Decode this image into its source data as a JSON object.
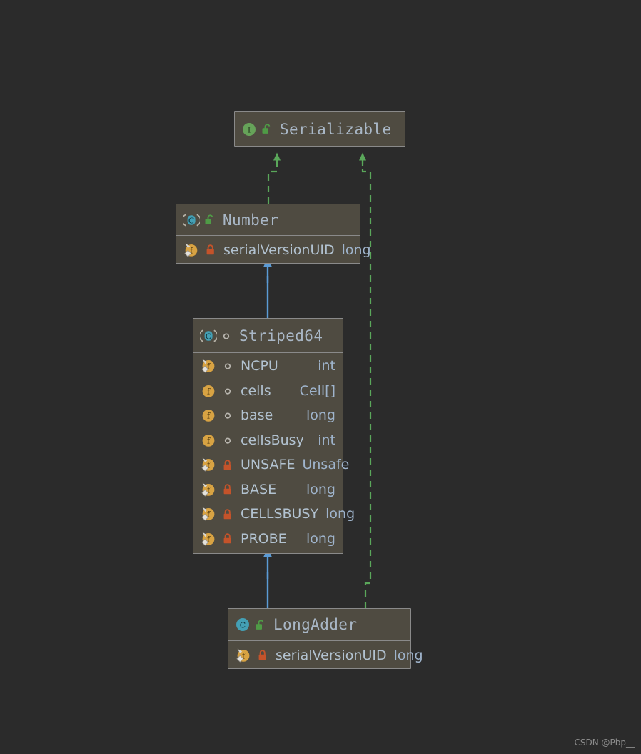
{
  "diagram": {
    "title": "UML Class Diagram",
    "background_color": "#2b2b2b",
    "node_fill_color": "#4f4b41",
    "node_border_color": "#8a8a8a",
    "inheritance_edge_color": "#5b9bd5",
    "realization_edge_color": "#5aa75a",
    "class_name_color": "#a9b7c6",
    "member_name_color": "#b2c2d0",
    "member_type_color": "#9fb4cc"
  },
  "nodes": [
    {
      "id": "serializable",
      "name": "Serializable",
      "stereotype_icon": "interface-icon",
      "visibility_icon": "unlock-public-icon",
      "members": []
    },
    {
      "id": "number",
      "name": "Number",
      "stereotype_icon": "abstract-class-icon",
      "visibility_icon": "unlock-public-icon",
      "members": [
        {
          "icon": "static-final-field-icon",
          "visibility_icon": "lock-private-icon",
          "name": "serialVersionUID",
          "type": "long"
        }
      ]
    },
    {
      "id": "striped64",
      "name": "Striped64",
      "stereotype_icon": "abstract-class-icon",
      "visibility_icon": "circle-package-private-icon",
      "members": [
        {
          "icon": "static-final-field-icon",
          "visibility_icon": "circle-package-private-icon",
          "name": "NCPU",
          "type": "int"
        },
        {
          "icon": "field-icon",
          "visibility_icon": "circle-package-private-icon",
          "name": "cells",
          "type": "Cell[]"
        },
        {
          "icon": "field-icon",
          "visibility_icon": "circle-package-private-icon",
          "name": "base",
          "type": "long"
        },
        {
          "icon": "field-icon",
          "visibility_icon": "circle-package-private-icon",
          "name": "cellsBusy",
          "type": "int"
        },
        {
          "icon": "static-final-field-icon",
          "visibility_icon": "lock-private-icon",
          "name": "UNSAFE",
          "type": "Unsafe"
        },
        {
          "icon": "static-final-field-icon",
          "visibility_icon": "lock-private-icon",
          "name": "BASE",
          "type": "long"
        },
        {
          "icon": "static-final-field-icon",
          "visibility_icon": "lock-private-icon",
          "name": "CELLSBUSY",
          "type": "long"
        },
        {
          "icon": "static-final-field-icon",
          "visibility_icon": "lock-private-icon",
          "name": "PROBE",
          "type": "long"
        }
      ]
    },
    {
      "id": "longadder",
      "name": "LongAdder",
      "stereotype_icon": "class-icon",
      "visibility_icon": "unlock-public-icon",
      "members": [
        {
          "icon": "static-final-field-icon",
          "visibility_icon": "lock-private-icon",
          "name": "serialVersionUID",
          "type": "long"
        }
      ]
    }
  ],
  "edges": [
    {
      "id": "number-to-serializable",
      "from": "number",
      "to": "serializable",
      "relation": "realization",
      "style": "dashed",
      "color": "#5aa75a"
    },
    {
      "id": "longadder-to-serializable",
      "from": "longadder",
      "to": "serializable",
      "relation": "realization",
      "style": "dashed",
      "color": "#5aa75a"
    },
    {
      "id": "striped64-to-number",
      "from": "striped64",
      "to": "number",
      "relation": "generalization",
      "style": "solid",
      "color": "#5b9bd5"
    },
    {
      "id": "longadder-to-striped64",
      "from": "longadder",
      "to": "striped64",
      "relation": "generalization",
      "style": "solid",
      "color": "#5b9bd5"
    }
  ],
  "watermark": {
    "text": "CSDN @Pbp__"
  }
}
